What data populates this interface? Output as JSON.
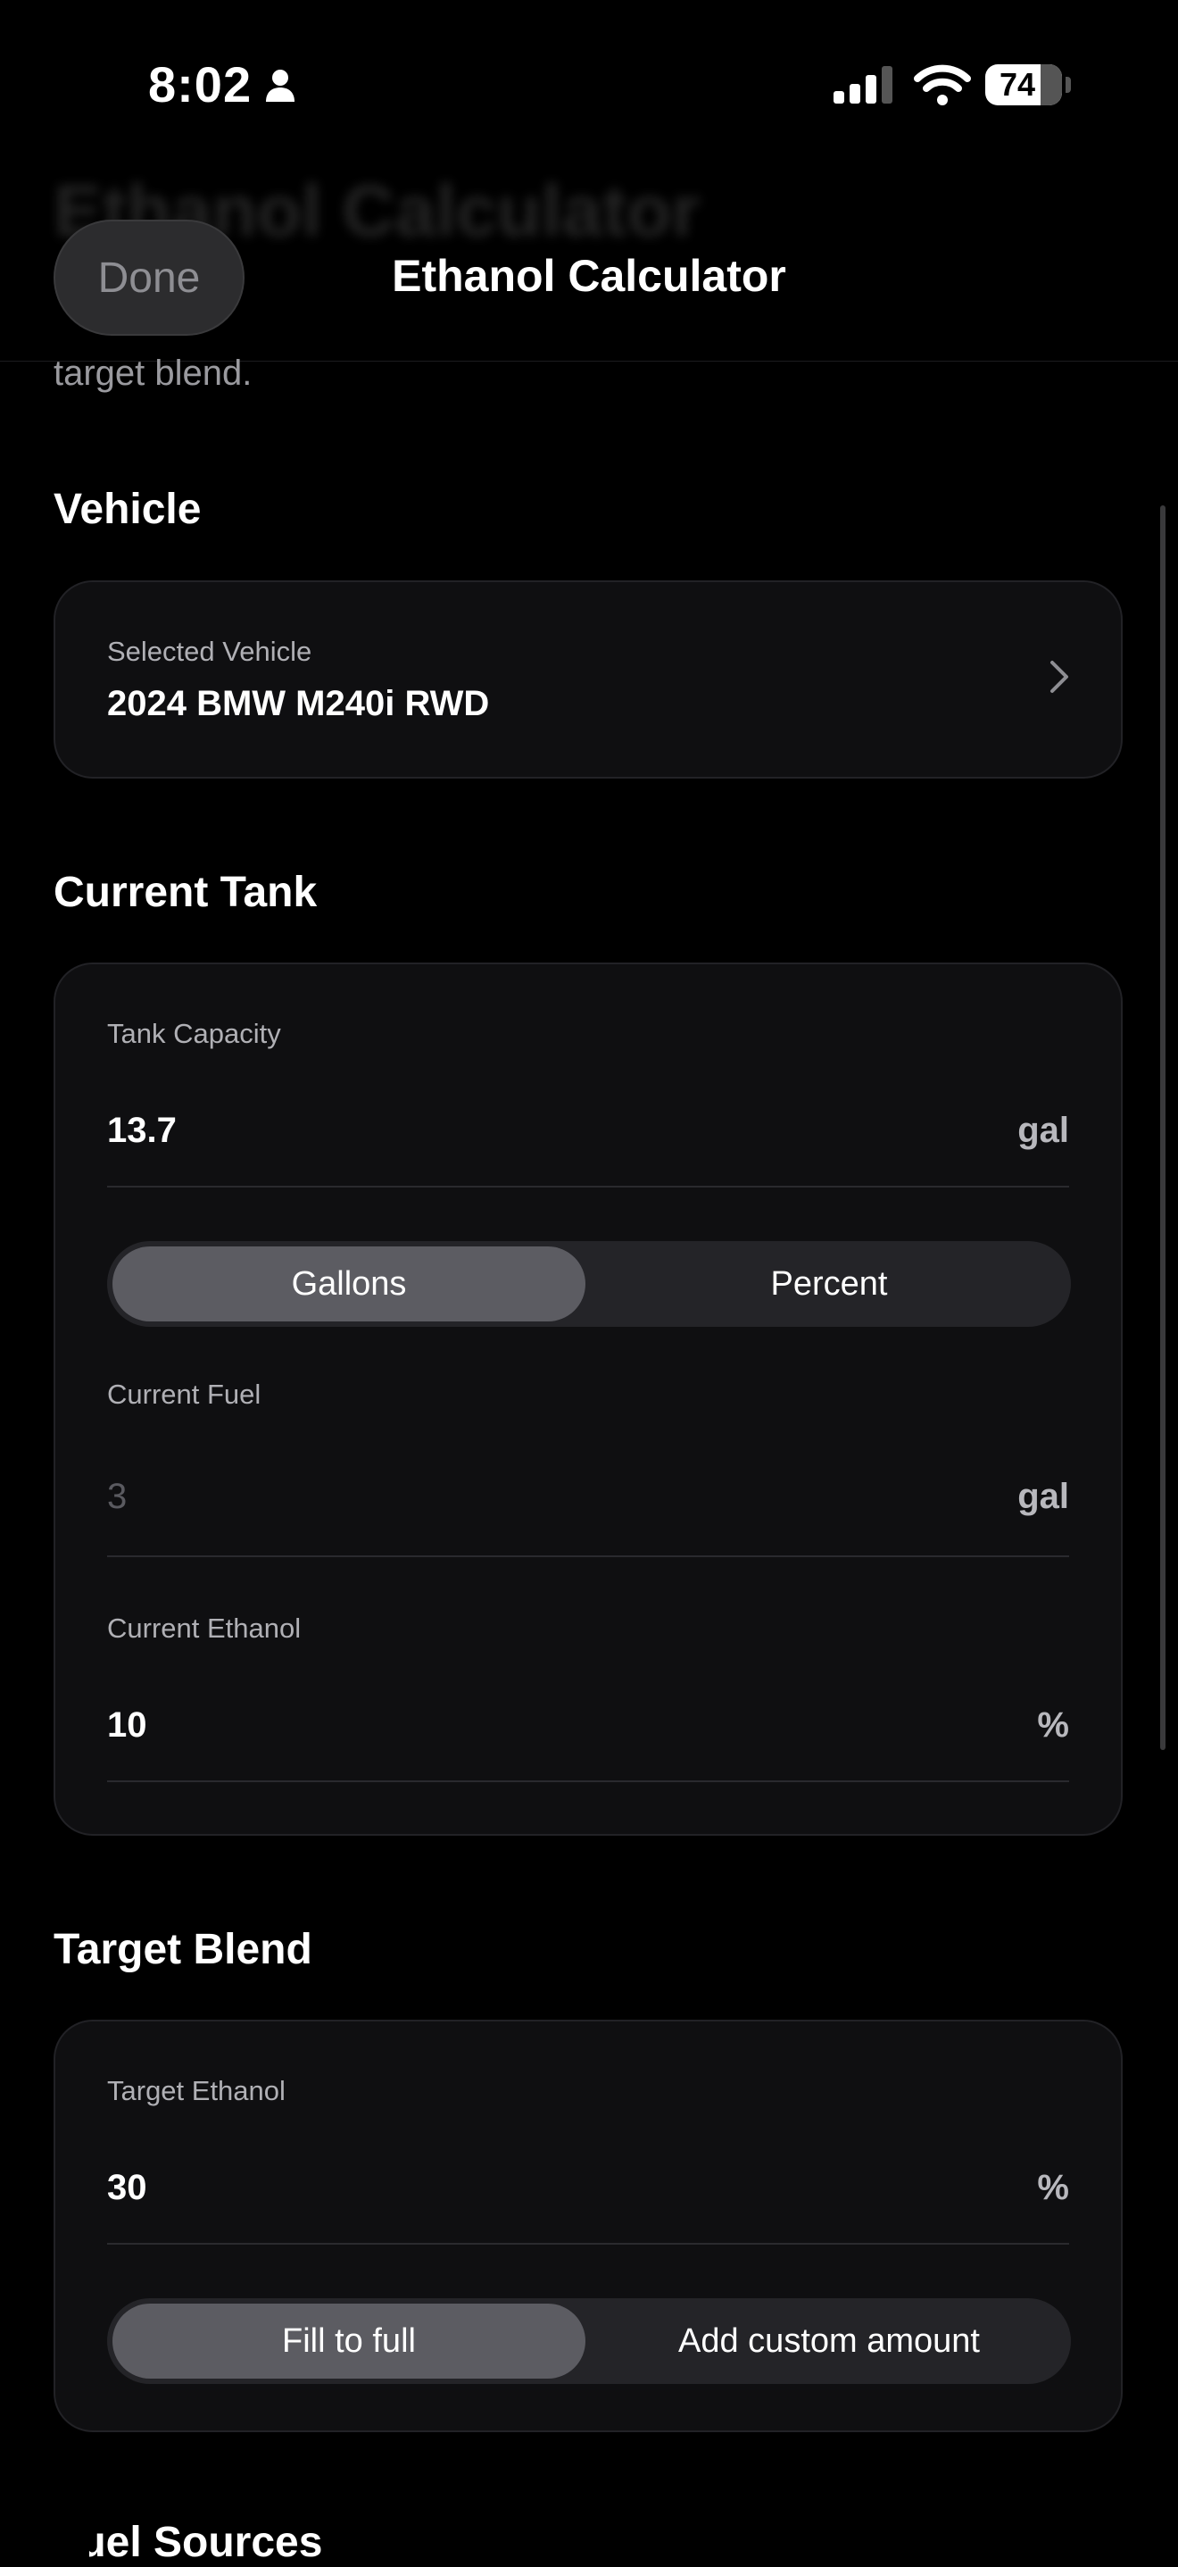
{
  "status_bar": {
    "time": "8:02",
    "battery": "74"
  },
  "nav": {
    "done_label": "Done",
    "title": "Ethanol Calculator",
    "scrolled_title": "Ethanol Calculator",
    "scrolled_subtitle": "target blend."
  },
  "vehicle": {
    "section_title": "Vehicle",
    "selected_label": "Selected Vehicle",
    "selected_value": "2024 BMW M240i RWD"
  },
  "current_tank": {
    "section_title": "Current Tank",
    "capacity_label": "Tank Capacity",
    "capacity_value": "13.7",
    "capacity_unit": "gal",
    "mode_options": [
      "Gallons",
      "Percent"
    ],
    "fuel_label": "Current Fuel",
    "fuel_placeholder": "3",
    "fuel_unit": "gal",
    "ethanol_label": "Current Ethanol",
    "ethanol_value": "10",
    "ethanol_unit": "%"
  },
  "target_blend": {
    "section_title": "Target Blend",
    "ethanol_label": "Target Ethanol",
    "ethanol_value": "30",
    "ethanol_unit": "%",
    "mode_options": [
      "Fill to full",
      "Add custom amount"
    ]
  },
  "next_section_title": "Fuel Sources"
}
